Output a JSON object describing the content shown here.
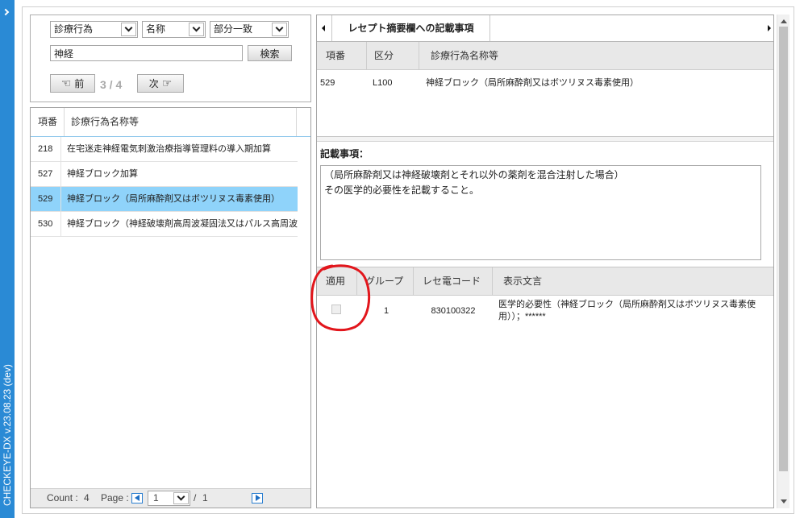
{
  "sidebar": {
    "toggle_icon": "chevron-right-icon",
    "version": "CHECKEYE-DX v.23.08.23 (dev)",
    "color": "#2a8ad5"
  },
  "search": {
    "category": "診療行為",
    "field": "名称",
    "match": "部分一致",
    "query": "神経",
    "search_button": "検索",
    "prev_button": "前",
    "prev_icon": "hand-pointing-left-icon",
    "position": "3 / 4",
    "next_button": "次",
    "next_icon": "hand-pointing-right-icon"
  },
  "results": {
    "columns": [
      "項番",
      "診療行為名称等"
    ],
    "rows": [
      {
        "no": "218",
        "name": "在宅迷走神経電気刺激治療指導管理料の導入期加算",
        "selected": false
      },
      {
        "no": "527",
        "name": "神経ブロック加算",
        "selected": false
      },
      {
        "no": "529",
        "name": "神経ブロック（局所麻酔剤又はボツリヌス毒素使用）",
        "selected": true
      },
      {
        "no": "530",
        "name": "神経ブロック（神経破壊剤高周波凝固法又はパルス高周波",
        "selected": false
      }
    ],
    "selected_color": "#8fd3fa",
    "footer": {
      "count_label": "Count :",
      "count": "4",
      "page_label": "Page :",
      "first_icon": "first-page-icon",
      "page": "1",
      "page_separator": "/",
      "total_pages": "1",
      "next_icon": "next-page-icon"
    }
  },
  "detail": {
    "tab": "レセプト摘要欄への記載事項",
    "columns": [
      "項番",
      "区分",
      "診療行為名称等"
    ],
    "row": {
      "no": "529",
      "category": "L100",
      "name": "神経ブロック（局所麻酔剤又はボツリヌス毒素使用）"
    },
    "notes_label": "記載事項：",
    "notes": "（局所麻酔剤又は神経破壊剤とそれ以外の薬剤を混合注射した場合）\nその医学的必要性を記載すること。",
    "comment_table": {
      "columns": [
        "適用",
        "グループ",
        "レセ電コード",
        "表示文言"
      ],
      "rows": [
        {
          "applied": false,
          "group": "1",
          "code": "830100322",
          "text": "医学的必要性（神経ブロック（局所麻酔剤又はボツリヌス毒素使用））；******"
        }
      ]
    }
  },
  "annotation": {
    "color": "#e2161c"
  }
}
